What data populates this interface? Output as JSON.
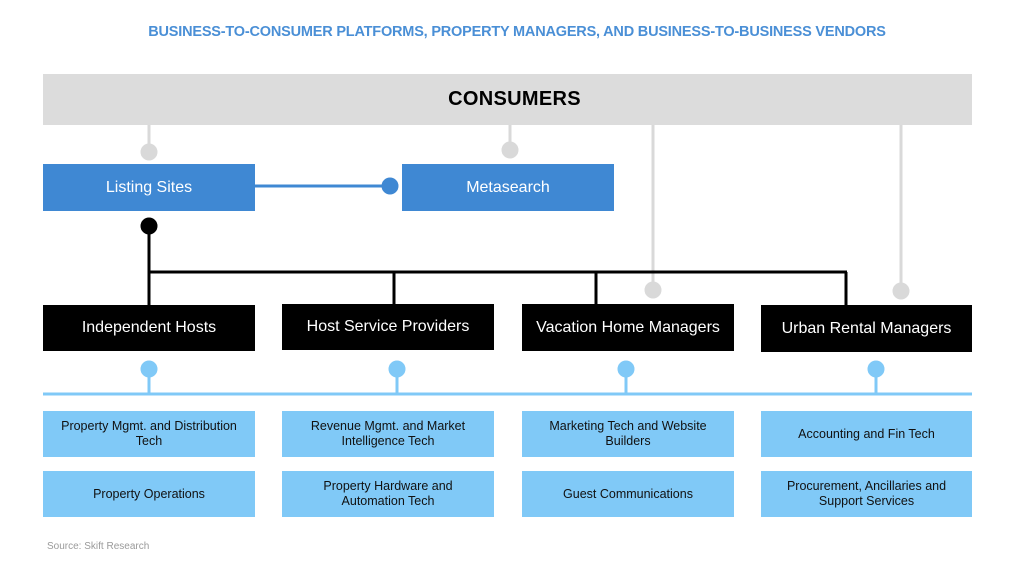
{
  "title": "BUSINESS-TO-CONSUMER PLATFORMS, PROPERTY MANAGERS, AND BUSINESS-TO-BUSINESS VENDORS",
  "consumers": {
    "label": "CONSUMERS"
  },
  "platforms": [
    {
      "label": "Listing Sites"
    },
    {
      "label": "Metasearch"
    }
  ],
  "hosts": [
    {
      "label": "Independent Hosts"
    },
    {
      "label": "Host Service Providers"
    },
    {
      "label": "Vacation Home Managers"
    },
    {
      "label": "Urban Rental Managers"
    }
  ],
  "vendors": [
    {
      "top": "Property Mgmt. and Distribution Tech",
      "bottom": "Property Operations"
    },
    {
      "top": "Revenue Mgmt. and Market Intelligence Tech",
      "bottom": "Property Hardware and Automation Tech"
    },
    {
      "top": "Marketing Tech and Website Builders",
      "bottom": "Guest Communications"
    },
    {
      "top": "Accounting and Fin Tech",
      "bottom": "Procurement, Ancillaries and Support Services"
    }
  ],
  "colors": {
    "title": "#4a8fd6",
    "consumers_bg": "#dcdcdc",
    "platform_bg": "#3f88d3",
    "host_bg": "#000000",
    "vendor_bg": "#80c9f7",
    "gray_connector": "#d9d9d9",
    "vendor_connector": "#80c9f7"
  },
  "source": "Source: Skift Research"
}
